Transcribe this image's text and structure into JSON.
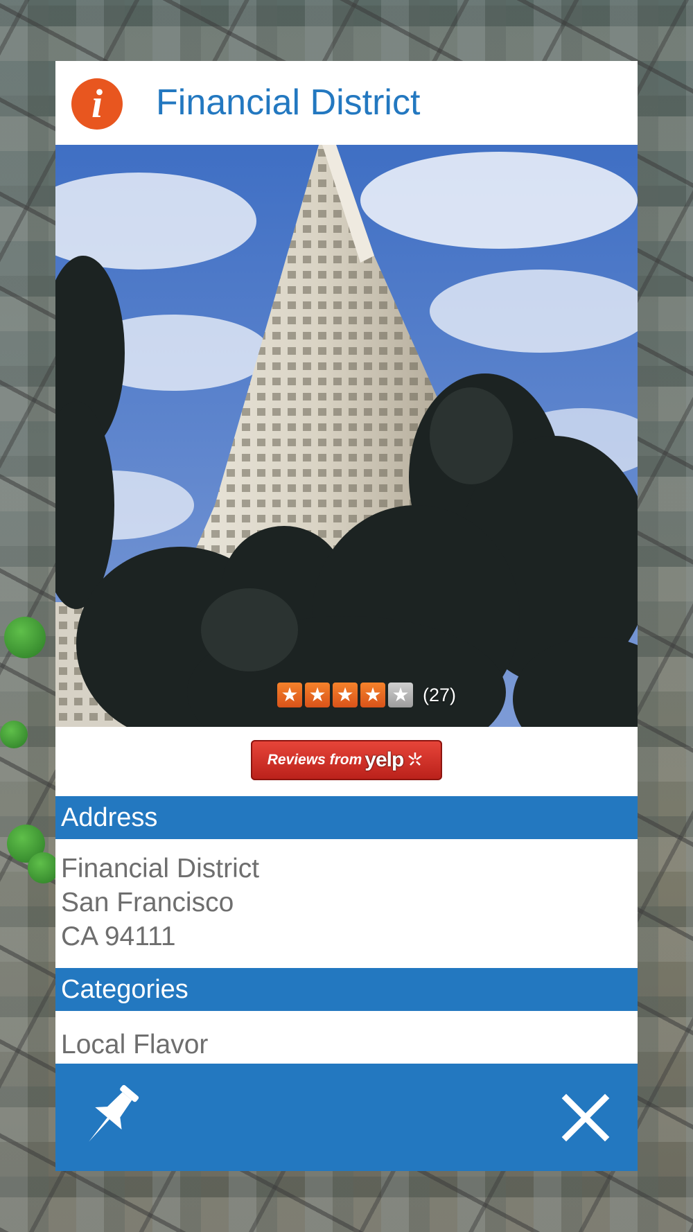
{
  "place": {
    "title": "Financial District",
    "photo_icon": "building-photo",
    "rating": {
      "stars_filled": 4,
      "stars_total": 5,
      "review_count_label": "(27)"
    }
  },
  "yelp": {
    "button_prefix": "Reviews from",
    "button_logo_text": "yelp",
    "button_colors": {
      "top": "#e8463a",
      "bottom": "#b9201a"
    }
  },
  "sections": {
    "address_header": "Address",
    "address_lines": [
      "Financial District",
      "San Francisco",
      "CA 94111"
    ],
    "categories_header": "Categories",
    "categories": [
      "Local Flavor"
    ]
  },
  "footer": {
    "pin_icon": "pushpin-icon",
    "close_icon": "close-icon"
  },
  "icons": {
    "info": {
      "name": "info-icon",
      "glyph": "i"
    }
  },
  "colors": {
    "accent_blue": "#2378c0",
    "info_orange": "#e8561f",
    "star_orange": "#f5822b",
    "text_gray": "#6e6e6e"
  }
}
